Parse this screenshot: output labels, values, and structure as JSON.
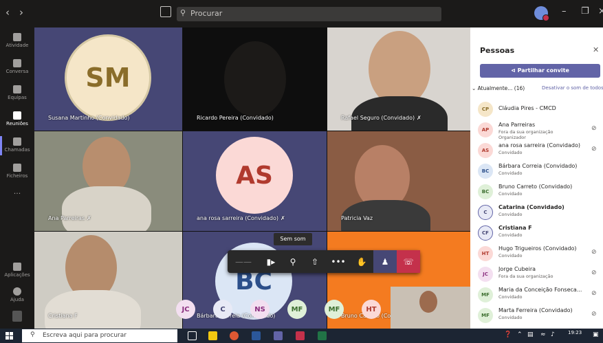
{
  "search": {
    "placeholder": "Procurar"
  },
  "rail": [
    {
      "label": "Atividade",
      "icon": "bell-icon"
    },
    {
      "label": "Conversa",
      "icon": "chat-icon"
    },
    {
      "label": "Equipas",
      "icon": "teams-icon"
    },
    {
      "label": "Reuniões",
      "icon": "calendar-icon"
    },
    {
      "label": "Chamadas",
      "icon": "phone-icon"
    },
    {
      "label": "Ficheiros",
      "icon": "file-icon"
    },
    {
      "label": "...",
      "icon": "more-icon"
    },
    {
      "label": "Aplicações",
      "icon": "apps-icon"
    },
    {
      "label": "Ajuda",
      "icon": "help-icon"
    }
  ],
  "tiles": [
    {
      "name": "Susana Martinho (Convidado)",
      "initials": "SM"
    },
    {
      "name": "Ricardo Pereira (Convidado)"
    },
    {
      "name": "Rafael Seguro (Convidado)"
    },
    {
      "name": "Ana Parreiras"
    },
    {
      "name": "ana rosa sarreira (Convidado)",
      "initials": "AS"
    },
    {
      "name": "Patricia Vaz"
    },
    {
      "name": "Cristiana F"
    },
    {
      "name": "Bárbara Correia (Convidado)",
      "initials": "BC"
    },
    {
      "name": "Bruno Carreto (Convidado)"
    }
  ],
  "tooltip": "Sem som",
  "bubbles": [
    "JC",
    "C",
    "NS",
    "MF",
    "MF",
    "HT"
  ],
  "panel": {
    "title": "Pessoas",
    "share": "Partilhar convite",
    "current": "Atualmente... (16)",
    "mute_all": "Desativar o som de todos",
    "people": [
      {
        "initials": "CP",
        "name": "Cláudia Pires - CMCD",
        "sub": "",
        "sub2": "",
        "color": "#f5e6c8",
        "fg": "#8a6d2a",
        "mic": false,
        "bold": false
      },
      {
        "initials": "AP",
        "name": "Ana Parreiras",
        "sub": "Fora da sua organização",
        "sub2": "Organizador",
        "color": "#fbd9d6",
        "fg": "#b03a2e",
        "mic": true,
        "bold": false
      },
      {
        "initials": "AS",
        "name": "ana rosa sarreira (Convidado)",
        "sub": "Convidado",
        "sub2": "",
        "color": "#fbd9d6",
        "fg": "#b03a2e",
        "mic": true,
        "bold": false
      },
      {
        "initials": "BC",
        "name": "Bárbara Correia (Convidado)",
        "sub": "Convidado",
        "sub2": "",
        "color": "#dbe6f5",
        "fg": "#2c4f8a",
        "mic": false,
        "bold": false
      },
      {
        "initials": "BC",
        "name": "Bruno Carreto (Convidado)",
        "sub": "Convidado",
        "sub2": "",
        "color": "#dff0d8",
        "fg": "#3c6e2f",
        "mic": false,
        "bold": false
      },
      {
        "initials": "C",
        "name": "Catarina (Convidado)",
        "sub": "Convidado",
        "sub2": "",
        "color": "#e8eaf6",
        "fg": "#464775",
        "mic": false,
        "bold": true
      },
      {
        "initials": "CF",
        "name": "Cristiana F",
        "sub": "Convidado",
        "sub2": "",
        "color": "#e8eaf6",
        "fg": "#464775",
        "mic": false,
        "bold": true
      },
      {
        "initials": "HT",
        "name": "Hugo Trigueiros (Convidado)",
        "sub": "Convidado",
        "sub2": "",
        "color": "#fbd9d6",
        "fg": "#b03a2e",
        "mic": true,
        "bold": false
      },
      {
        "initials": "JC",
        "name": "Jorge Cubeira",
        "sub": "Fora da sua organização",
        "sub2": "",
        "color": "#f3dff0",
        "fg": "#8a2e7e",
        "mic": true,
        "bold": false
      },
      {
        "initials": "MF",
        "name": "Maria da Conceição Fonseca...",
        "sub": "Convidado",
        "sub2": "",
        "color": "#dff0d8",
        "fg": "#3c6e2f",
        "mic": true,
        "bold": false
      },
      {
        "initials": "MF",
        "name": "Marta Ferreira (Convidado)",
        "sub": "Convidado",
        "sub2": "",
        "color": "#dff0d8",
        "fg": "#3c6e2f",
        "mic": true,
        "bold": false
      }
    ]
  },
  "taskbar": {
    "search": "Escreva aqui para procurar",
    "time": "19:23"
  }
}
